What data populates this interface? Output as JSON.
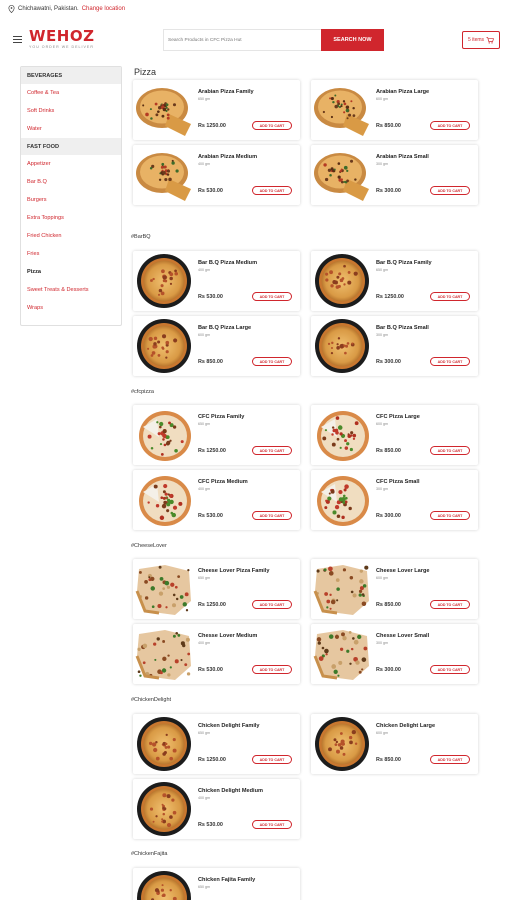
{
  "location": {
    "text": "Chichawatni, Pakistan.",
    "change": "Change location"
  },
  "header": {
    "logo": "WEHOZ",
    "tagline": "YOU ORDER WE DELIVER",
    "search_placeholder": "Search Products in CFC Pizza Hut",
    "search_button": "SEARCH NOW",
    "cart": "5 items"
  },
  "sidebar": {
    "beverages_head": "BEVERAGES",
    "beverages": [
      "Coffee & Tea",
      "Soft Drinks",
      "Water"
    ],
    "fastfood_head": "FAST FOOD",
    "fastfood": [
      "Appetizer",
      "Bar B.Q",
      "Burgers",
      "Extra Toppings",
      "Fried Chicken",
      "Fries",
      "Pizza",
      "Sweet Treats & Desserts",
      "Wraps"
    ]
  },
  "main": {
    "title": "Pizza",
    "add_label": "ADD TO CART",
    "sections": [
      {
        "hash": "",
        "items": [
          {
            "name": "Arabian Pizza Family",
            "weight": "650 gm",
            "price": "Rs 1250.00"
          },
          {
            "name": "Arabian Pizza Large",
            "weight": "600 gm",
            "price": "Rs 850.00"
          },
          {
            "name": "Arabian Pizza Medium",
            "weight": "400 gm",
            "price": "Rs 530.00"
          },
          {
            "name": "Arabian Pizza Small",
            "weight": "300 gm",
            "price": "Rs 300.00"
          }
        ]
      },
      {
        "hash": "#BarBQ",
        "items": [
          {
            "name": "Bar B.Q Pizza Medium",
            "weight": "400 gm",
            "price": "Rs 530.00"
          },
          {
            "name": "Bar B.Q Pizza Family",
            "weight": "650 gm",
            "price": "Rs 1250.00"
          },
          {
            "name": "Bar B.Q Pizza Large",
            "weight": "600 gm",
            "price": "Rs 850.00"
          },
          {
            "name": "Bar B.Q Pizza Small",
            "weight": "300 gm",
            "price": "Rs 300.00"
          }
        ]
      },
      {
        "hash": "#cfcpizza",
        "items": [
          {
            "name": "CFC Pizza Family",
            "weight": "650 gm",
            "price": "Rs 1250.00"
          },
          {
            "name": "CFC Pizza Large",
            "weight": "600 gm",
            "price": "Rs 850.00"
          },
          {
            "name": "CFC Pizza Medium",
            "weight": "400 gm",
            "price": "Rs 530.00"
          },
          {
            "name": "CFC Pizza Small",
            "weight": "300 gm",
            "price": "Rs 300.00"
          }
        ]
      },
      {
        "hash": "#CheeseLover",
        "items": [
          {
            "name": "Cheese Lover Pizza Family",
            "weight": "650 gm",
            "price": "Rs 1250.00"
          },
          {
            "name": "Cheese Lover Large",
            "weight": "600 gm",
            "price": "Rs 850.00"
          },
          {
            "name": "Chesse Lover Medium",
            "weight": "400 gm",
            "price": "Rs 530.00"
          },
          {
            "name": "Chesse Lover Small",
            "weight": "300 gm",
            "price": "Rs 300.00"
          }
        ]
      },
      {
        "hash": "#ChickenDelight",
        "items": [
          {
            "name": "Chicken Delight Family",
            "weight": "650 gm",
            "price": "Rs 1250.00"
          },
          {
            "name": "Chicken Delight Large",
            "weight": "600 gm",
            "price": "Rs 850.00"
          },
          {
            "name": "Chicken Delight Medium",
            "weight": "400 gm",
            "price": "Rs 530.00"
          }
        ]
      },
      {
        "hash": "#ChickenFajita",
        "items": [
          {
            "name": "Chicken Fajita Family",
            "weight": "650 gm",
            "price": ""
          }
        ]
      }
    ]
  },
  "colors": {
    "brand": "#d0262d"
  }
}
